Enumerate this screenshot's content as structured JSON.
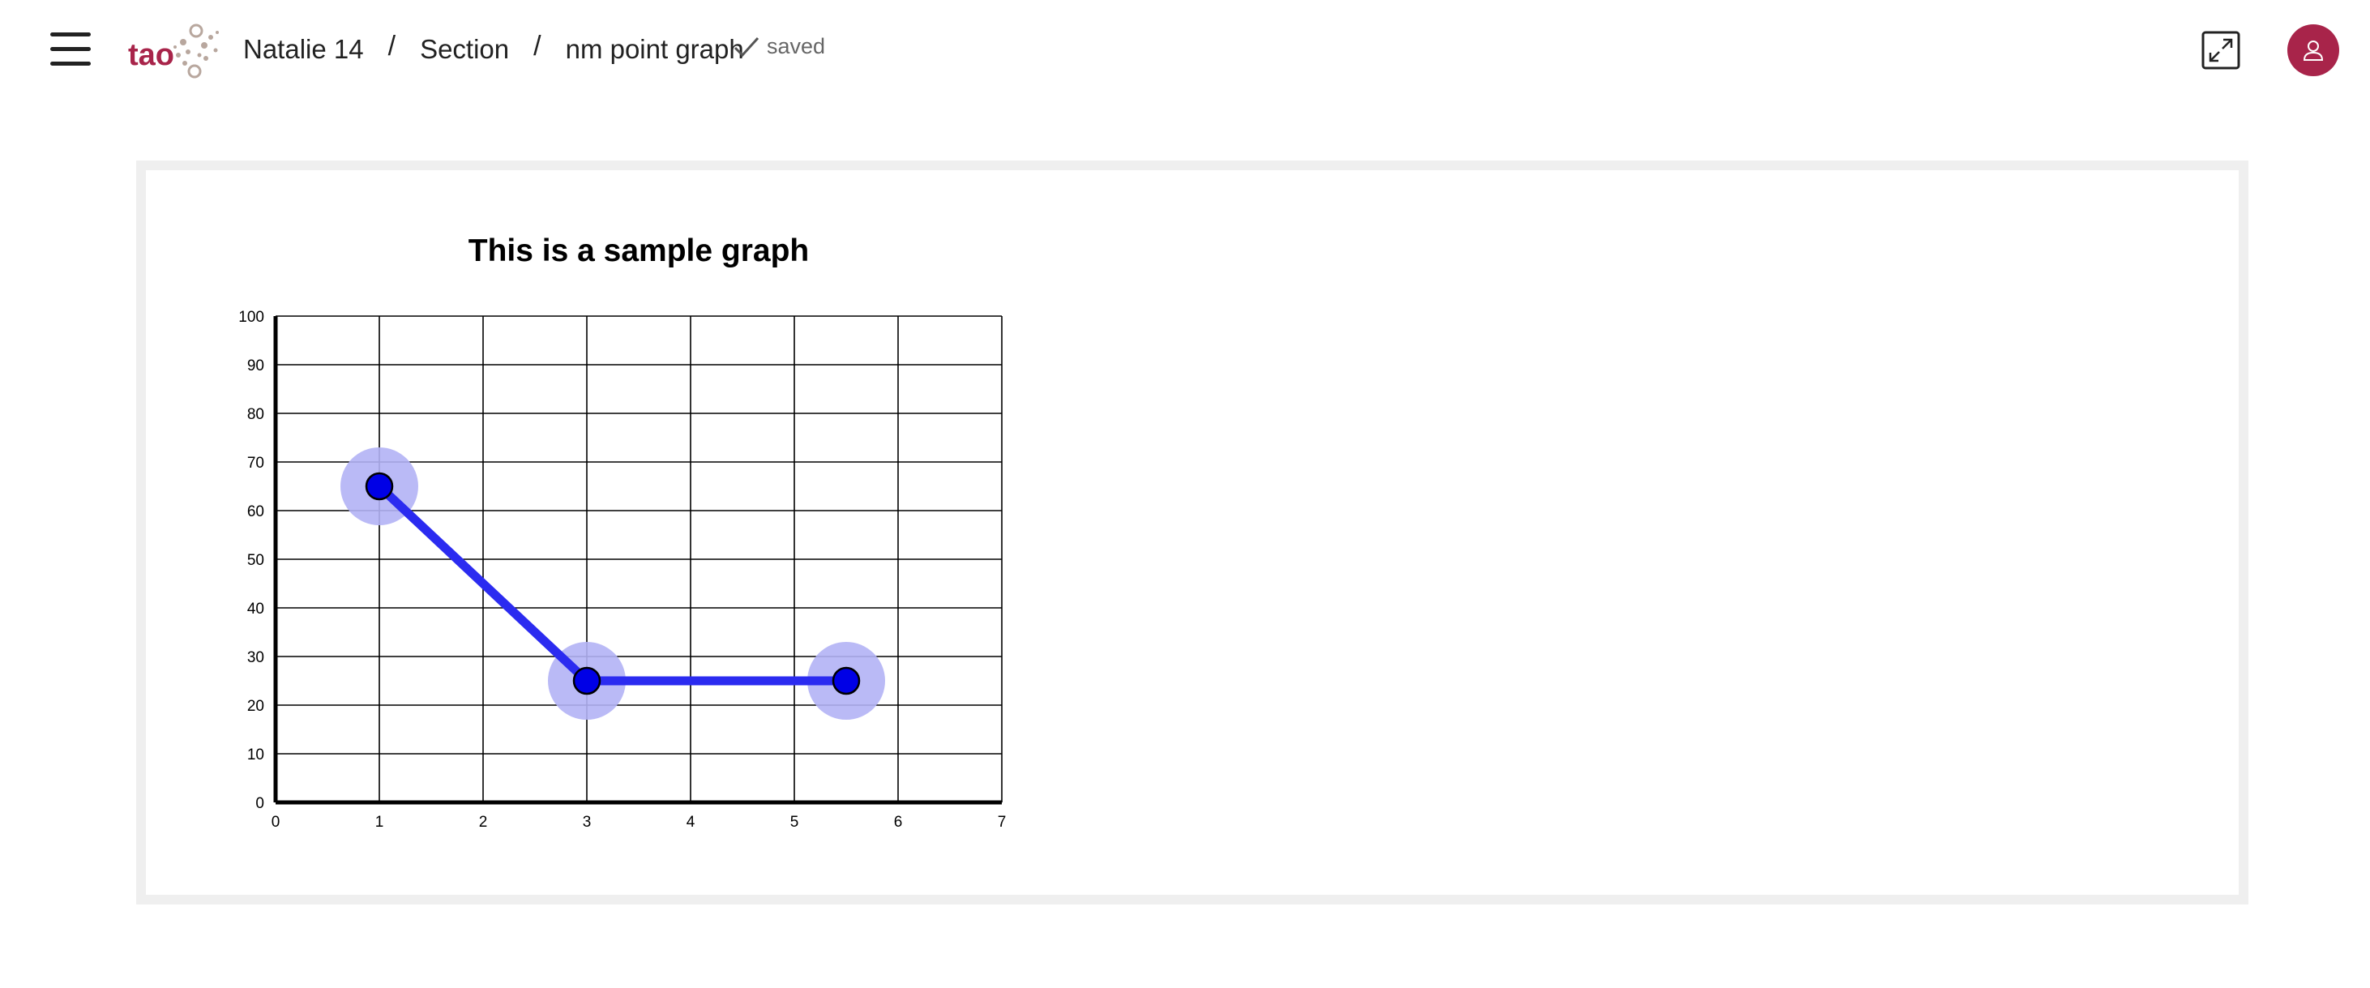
{
  "header": {
    "breadcrumb": [
      {
        "label": "Natalie 14"
      },
      {
        "label": "Section"
      },
      {
        "label": "nm point graph"
      }
    ],
    "separator": "/",
    "status": "saved",
    "logo_text": "tao"
  },
  "colors": {
    "brand": "#a8244a",
    "line": "#2b2bf0",
    "point": "#0000e6",
    "halo": "#b3b3f5"
  },
  "icons": {
    "menu": "hamburger-icon",
    "status": "check-icon",
    "expand": "expand-icon",
    "user": "user-icon"
  },
  "chart_data": {
    "type": "line",
    "title": "This is a sample graph",
    "xlabel": "",
    "ylabel": "",
    "xlim": [
      0,
      7
    ],
    "ylim": [
      0,
      100
    ],
    "x_ticks": [
      "0",
      "1",
      "2",
      "3",
      "4",
      "5",
      "6",
      "7"
    ],
    "y_ticks": [
      "0",
      "10",
      "20",
      "30",
      "40",
      "50",
      "60",
      "70",
      "80",
      "90",
      "100"
    ],
    "grid": true,
    "series": [
      {
        "points": [
          {
            "x": 1,
            "y": 65
          },
          {
            "x": 3,
            "y": 25
          },
          {
            "x": 5.5,
            "y": 25
          }
        ]
      }
    ]
  }
}
